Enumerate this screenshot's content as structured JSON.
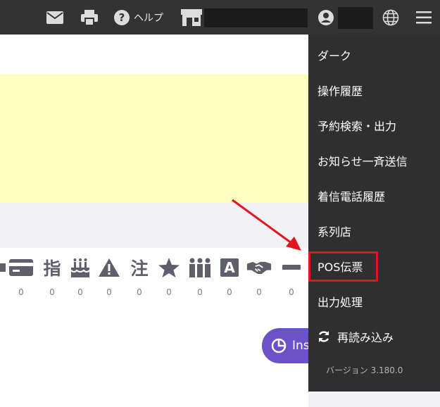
{
  "topbar": {
    "help_label": "ヘルプ",
    "icons": [
      "mail-icon",
      "print-icon",
      "help-icon",
      "store-icon",
      "user-icon",
      "globe-icon",
      "menu-icon"
    ]
  },
  "toolbar_icons": [
    {
      "name": "card-icon",
      "glyph": "",
      "count": "0"
    },
    {
      "name": "finger-icon",
      "glyph": "指",
      "count": "0"
    },
    {
      "name": "birthday-cake-icon",
      "glyph": "",
      "count": "0"
    },
    {
      "name": "warning-icon",
      "glyph": "",
      "count": "0"
    },
    {
      "name": "note-icon",
      "glyph": "注",
      "count": "0"
    },
    {
      "name": "star-icon",
      "glyph": "",
      "count": "0"
    },
    {
      "name": "group-icon",
      "glyph": "",
      "count": "0"
    },
    {
      "name": "a-box-icon",
      "glyph": "A",
      "count": "0"
    },
    {
      "name": "handshake-icon",
      "glyph": "",
      "count": "0"
    },
    {
      "name": "minus-icon",
      "glyph": "",
      "count": "0"
    }
  ],
  "insights_button": {
    "label": "Ins"
  },
  "dropdown": {
    "items": [
      "ダーク",
      "操作履歴",
      "予約検索・出力",
      "お知らせ一斉送信",
      "着信電話履歴",
      "系列店",
      "POS伝票",
      "出力処理"
    ],
    "reload_label": "再読み込み",
    "version": "バージョン 3.180.0"
  },
  "colors": {
    "topbar": "#333333",
    "dropdown": "#2f2f2f",
    "highlight": "#e3141e",
    "yellow": "#ffffc2",
    "button": "#6b52c8"
  }
}
